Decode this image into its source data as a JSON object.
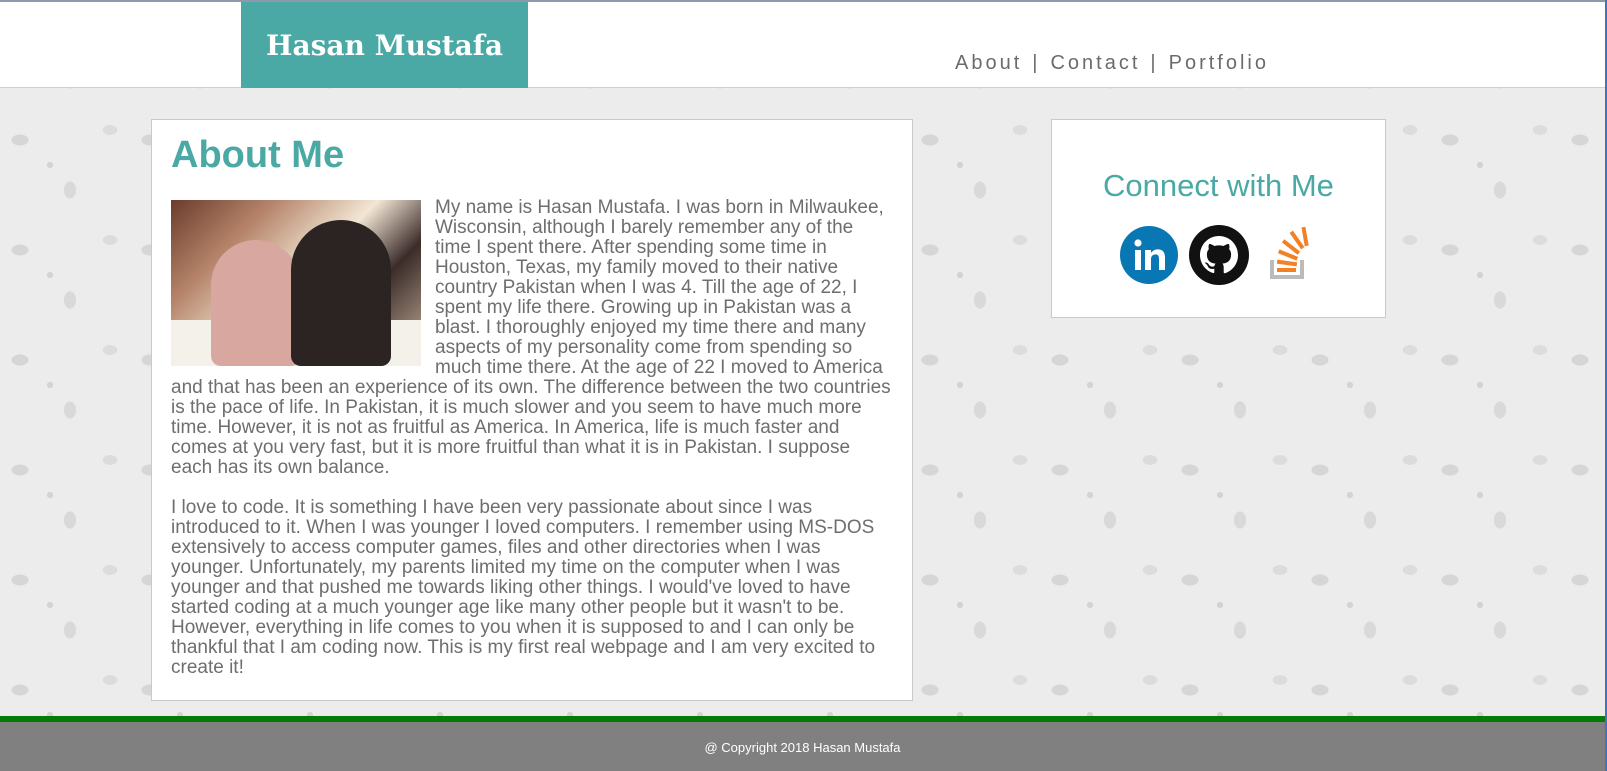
{
  "header": {
    "logo_text": "Hasan Mustafa",
    "nav": [
      {
        "label": "About"
      },
      {
        "label": "Contact"
      },
      {
        "label": "Portfolio"
      }
    ],
    "separator": "|"
  },
  "about": {
    "title": "About Me",
    "paragraphs": [
      "My name is Hasan Mustafa. I was born in Milwaukee, Wisconsin, although I barely remember any of the time I spent there. After spending some time in Houston, Texas, my family moved to their native country Pakistan when I was 4. Till the age of 22, I spent my life there. Growing up in Pakistan was a blast. I thoroughly enjoyed my time there and many aspects of my personality come from spending so much time there. At the age of 22 I moved to America and that has been an experience of its own. The difference between the two countries is the pace of life. In Pakistan, it is much slower and you seem to have much more time. However, it is not as fruitful as America. In America, life is much faster and comes at you very fast, but it is more fruitful than what it is in Pakistan. I suppose each has its own balance.",
      "I love to code. It is something I have been very passionate about since I was introduced to it. When I was younger I loved computers. I remember using MS-DOS extensively to access computer games, files and other directories when I was younger. Unfortunately, my parents limited my time on the computer when I was younger and that pushed me towards liking other things. I would've loved to have started coding at a much younger age like many other people but it wasn't to be. However, everything in life comes to you when it is supposed to and I can only be thankful that I am coding now. This is my first real webpage and I am very excited to create it!"
    ]
  },
  "connect": {
    "title": "Connect with Me",
    "icons": [
      "linkedin-icon",
      "github-icon",
      "stackoverflow-icon"
    ]
  },
  "footer": {
    "text": "@ Copyright 2018 Hasan Mustafa"
  },
  "colors": {
    "accent": "#4aa9a5",
    "footer_bg": "#808080",
    "footer_stripe": "#067a06",
    "linkedin": "#0a77b5",
    "stackoverflow": "#f48024"
  }
}
